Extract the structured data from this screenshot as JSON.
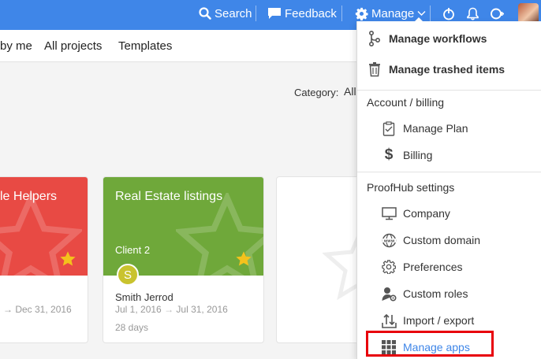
{
  "topbar": {
    "search_label": "Search",
    "feedback_label": "Feedback",
    "manage_label": "Manage",
    "bg_color": "#3f86e8"
  },
  "tabs": [
    "by me",
    "All projects",
    "Templates"
  ],
  "filters": {
    "category_label": "Category:",
    "category_value": "All"
  },
  "cards": [
    {
      "title": "le Helpers",
      "color": "#e84a44",
      "dates": "→ Dec 31, 2016"
    },
    {
      "title": "Real Estate listings",
      "color": "#6fa83a",
      "client": "Client 2",
      "owner_initial": "S",
      "owner_name": "Smith Jerrod",
      "date_start": "Jul 1, 2016",
      "date_end": "Jul 31, 2016",
      "duration": "28 days"
    }
  ],
  "manage_menu": {
    "top_items": [
      {
        "label": "Manage workflows",
        "icon": "workflow-icon"
      },
      {
        "label": "Manage trashed items",
        "icon": "trash-icon"
      }
    ],
    "sections": [
      {
        "heading": "Account / billing",
        "items": [
          {
            "label": "Manage Plan",
            "icon": "clipboard-icon"
          },
          {
            "label": "Billing",
            "icon": "dollar-icon"
          }
        ]
      },
      {
        "heading": "ProofHub settings",
        "items": [
          {
            "label": "Company",
            "icon": "monitor-icon"
          },
          {
            "label": "Custom domain",
            "icon": "www-globe-icon"
          },
          {
            "label": "Preferences",
            "icon": "gear-icon"
          },
          {
            "label": "Custom roles",
            "icon": "user-gear-icon"
          },
          {
            "label": "Import / export",
            "icon": "import-export-icon"
          },
          {
            "label": "Manage apps",
            "icon": "apps-grid-icon"
          }
        ]
      }
    ]
  }
}
